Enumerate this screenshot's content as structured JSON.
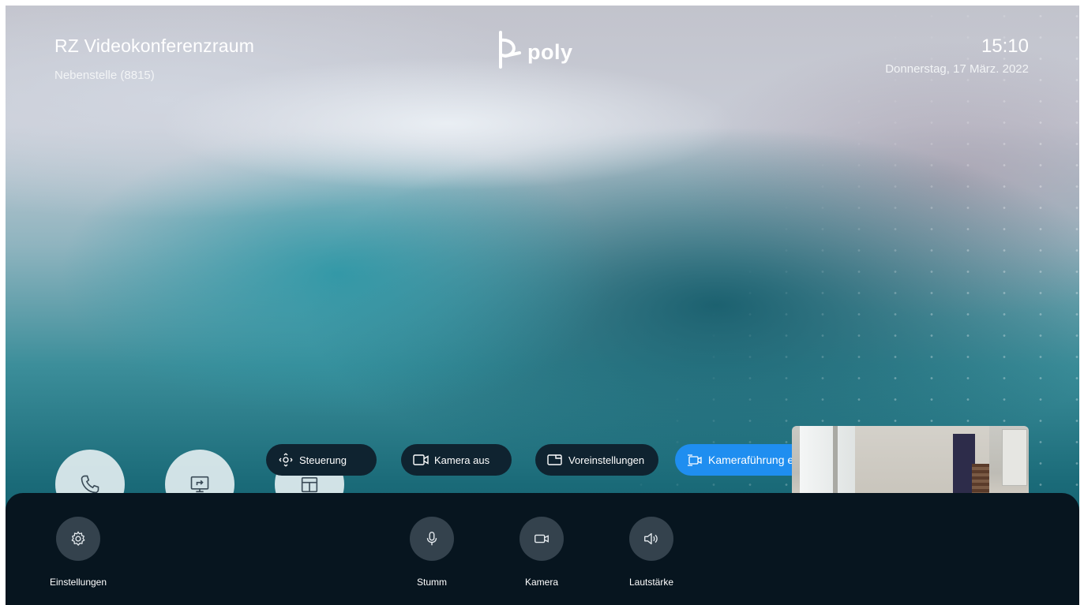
{
  "header": {
    "room_name": "RZ Videokonferenzraum",
    "extension": "Nebenstelle (8815)",
    "logo_text": "poly",
    "time": "15:10",
    "date": "Donnerstag, 17 März. 2022"
  },
  "home_buttons": [
    {
      "icon": "phone-icon"
    },
    {
      "icon": "share-screen-icon"
    },
    {
      "icon": "calendar-icon"
    }
  ],
  "camera_controls": {
    "steuerung": "Steuerung",
    "kamera_aus": "Kamera aus",
    "voreinstellungen": "Voreinstellungen",
    "kamerafuehrung": "Kameraführung ein"
  },
  "bottom_bar": {
    "settings": "Einstellungen",
    "mute": "Stumm",
    "camera": "Kamera",
    "volume": "Lautstärke"
  },
  "colors": {
    "accent": "#1f8ef0",
    "pill_bg": "#0f2330",
    "bar_bg": "#07151f",
    "control_bg": "#34424d"
  }
}
